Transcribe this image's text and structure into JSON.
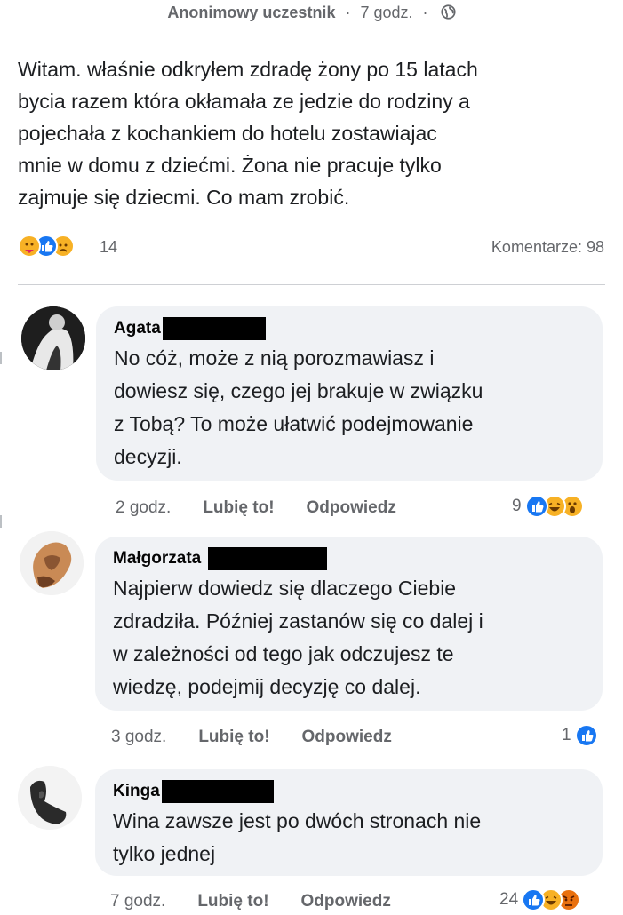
{
  "post": {
    "author": "Anonimowy uczestnik",
    "separator": "·",
    "time": "7 godz.",
    "separator2": "·",
    "text": "Witam. właśnie odkryłem zdradę żony po 15 latach\nbycia razem która okłamała  ze jedzie do rodziny a\npojechała z kochankiem do hotelu zostawiajac\nmnie w domu z dziećmi. Żona nie pracuje tylko\nzajmuje się dziecmi. Co mam zrobić.",
    "reaction_count": "14",
    "comments_label": "Komentarze: 98",
    "reaction_icons": [
      "care",
      "like",
      "sad"
    ]
  },
  "comments": [
    {
      "name": "Agata",
      "text": "No cóż, może z nią porozmawiasz i\ndowiesz się, czego jej brakuje w związku\nz Tobą? To może ułatwić podejmowanie\ndecyzji.",
      "time": "2 godz.",
      "like_label": "Lubię to!",
      "reply_label": "Odpowiedz",
      "reaction_count": "9",
      "reaction_icons": [
        "like",
        "haha",
        "wow"
      ]
    },
    {
      "name": "Małgorzata",
      "text": "Najpierw dowiedz się dlaczego Ciebie\nzdradziła. Później zastanów się co dalej i\nw zależności od tego jak odczujesz te\nwiedzę, podejmij decyzję co dalej.",
      "time": "3 godz.",
      "like_label": "Lubię to!",
      "reply_label": "Odpowiedz",
      "reaction_count": "1",
      "reaction_icons": [
        "like"
      ]
    },
    {
      "name": "Kinga",
      "text": "Wina zawsze jest po dwóch stronach nie\ntylko jednej",
      "time": "7 godz.",
      "like_label": "Lubię to!",
      "reply_label": "Odpowiedz",
      "reaction_count": "24",
      "reaction_icons": [
        "like",
        "haha",
        "angry"
      ]
    }
  ],
  "colors": {
    "like": "#1877f2",
    "haha": "#f7b125",
    "wow": "#f7b125",
    "care": "#f7b125",
    "sad": "#f7b125",
    "angry": "#e9710f",
    "bubble": "#f0f2f5",
    "secondary_text": "#65676b"
  }
}
